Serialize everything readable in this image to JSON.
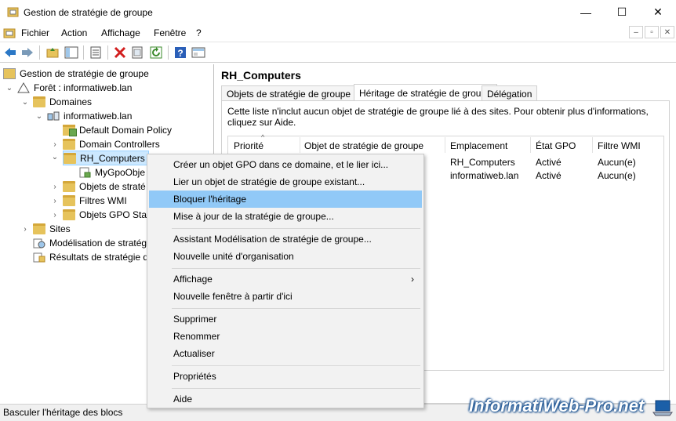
{
  "window": {
    "title": "Gestion de stratégie de groupe",
    "minimize": "—",
    "maximize": "☐",
    "close": "✕"
  },
  "menubar": {
    "items": [
      "Fichier",
      "Action",
      "Affichage",
      "Fenêtre",
      "?"
    ],
    "mdi": [
      "–",
      "▫",
      "✕"
    ]
  },
  "toolbar": {
    "icons": [
      "back-icon",
      "forward-icon",
      "up-folder-icon",
      "show-hide-tree-icon",
      "properties-icon",
      "delete-icon",
      "export-icon",
      "refresh-icon",
      "help-icon",
      "console-icon"
    ]
  },
  "tree": [
    {
      "label": "Gestion de stratégie de groupe",
      "icon": "gpm-icon"
    },
    {
      "label": "Forêt : informatiweb.lan",
      "icon": "forest-icon"
    },
    {
      "label": "Domaines",
      "icon": "domains-icon"
    },
    {
      "label": "informatiweb.lan",
      "icon": "domain-icon"
    },
    {
      "label": "Default Domain Policy",
      "icon": "gpo-link-icon"
    },
    {
      "label": "Domain Controllers",
      "icon": "ou-icon"
    },
    {
      "label": "RH_Computers",
      "icon": "ou-icon"
    },
    {
      "label": "MyGpoObje",
      "icon": "gpo-link-icon"
    },
    {
      "label": "Objets de straté",
      "icon": "folder-icon"
    },
    {
      "label": "Filtres WMI",
      "icon": "folder-icon"
    },
    {
      "label": "Objets GPO Star",
      "icon": "folder-icon"
    },
    {
      "label": "Sites",
      "icon": "sites-icon"
    },
    {
      "label": "Modélisation de stratég",
      "icon": "modeling-icon"
    },
    {
      "label": "Résultats de stratégie d",
      "icon": "results-icon"
    }
  ],
  "right": {
    "title": "RH_Computers",
    "tabs": [
      "Objets de stratégie de groupe liés",
      "Héritage de stratégie de groupe",
      "Délégation"
    ],
    "active_tab": "Héritage de stratégie de groupe",
    "info": "Cette liste n'inclut aucun objet de stratégie de groupe lié à des sites. Pour obtenir plus d'informations, cliquez sur Aide.",
    "columns": [
      "Priorité",
      "Objet de stratégie de groupe",
      "Emplacement",
      "État GPO",
      "Filtre WMI"
    ],
    "rows": [
      {
        "emplacement": "RH_Computers",
        "etat": "Activé",
        "filtre": "Aucun(e)"
      },
      {
        "emplacement": "informatiweb.lan",
        "etat": "Activé",
        "filtre": "Aucun(e)"
      }
    ]
  },
  "context_menu": {
    "items": [
      "Créer un objet GPO dans ce domaine, et le lier ici...",
      "Lier un objet de stratégie de groupe existant...",
      "Bloquer l'héritage",
      "Mise à jour de la stratégie de groupe...",
      "Assistant Modélisation de stratégie de groupe...",
      "Nouvelle unité d'organisation",
      "Affichage",
      "Nouvelle fenêtre à partir d'ici",
      "Supprimer",
      "Renommer",
      "Actualiser",
      "Propriétés",
      "Aide"
    ],
    "highlighted": "Bloquer l'héritage",
    "submenu_arrow": "›"
  },
  "status": {
    "text": "Basculer l'héritage des blocs"
  },
  "watermark": "InformatiWeb-Pro.net",
  "colors": {
    "highlight": "#91c9f7",
    "selection": "#cce8ff",
    "folder": "#e6c35c"
  }
}
